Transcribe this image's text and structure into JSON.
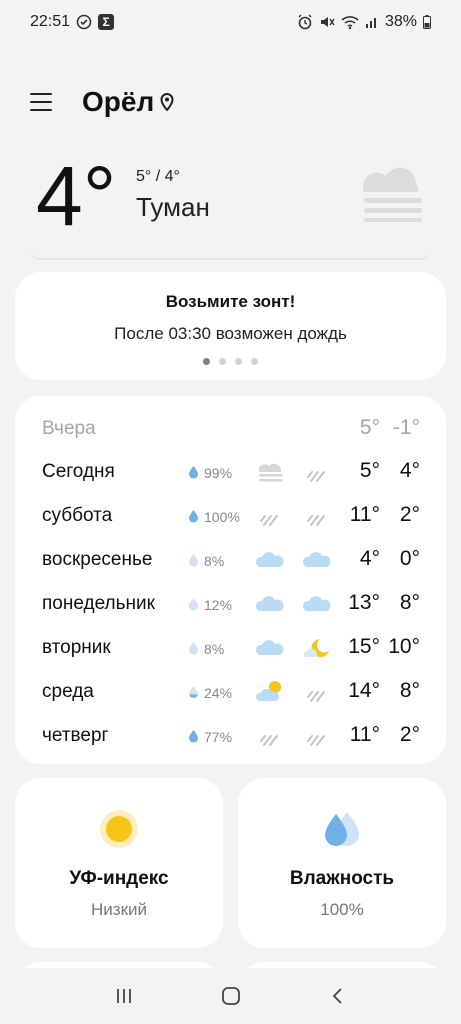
{
  "status_bar": {
    "time": "22:51",
    "battery": "38%",
    "icons": [
      "check-circle-icon",
      "sigma-icon",
      "alarm-icon",
      "mute-icon",
      "wifi-icon",
      "signal-icon",
      "battery-icon"
    ]
  },
  "header": {
    "city": "Орёл",
    "menu_icon": "menu-icon",
    "location_icon": "location-pin-icon"
  },
  "current": {
    "temp": "4°",
    "hilo": "5° / 4°",
    "condition": "Туман",
    "icon": "fog-icon"
  },
  "umbrella_card": {
    "title": "Возьмите зонт!",
    "text": "После 03:30 возможен дождь",
    "page_count": 4,
    "active_page": 1
  },
  "forecast": {
    "yesterday": {
      "day": "Вчера",
      "hi": "5°",
      "lo": "-1°"
    },
    "days": [
      {
        "day": "Сегодня",
        "pct": "99%",
        "icon1": "fog-icon",
        "icon2": "rain-icon",
        "hi": "5°",
        "lo": "4°"
      },
      {
        "day": "суббота",
        "pct": "100%",
        "icon1": "rain-icon",
        "icon2": "rain-icon",
        "hi": "11°",
        "lo": "2°"
      },
      {
        "day": "воскресенье",
        "pct": "8%",
        "icon1": "cloud-icon",
        "icon2": "cloud-icon",
        "hi": "4°",
        "lo": "0°"
      },
      {
        "day": "понедельник",
        "pct": "12%",
        "icon1": "cloud-icon",
        "icon2": "cloud-icon",
        "hi": "13°",
        "lo": "8°"
      },
      {
        "day": "вторник",
        "pct": "8%",
        "icon1": "cloud-icon",
        "icon2": "moon-cloud-icon",
        "hi": "15°",
        "lo": "10°"
      },
      {
        "day": "среда",
        "pct": "24%",
        "icon1": "sun-cloud-icon",
        "icon2": "rain-icon",
        "hi": "14°",
        "lo": "8°"
      },
      {
        "day": "четверг",
        "pct": "77%",
        "icon1": "rain-icon",
        "icon2": "rain-icon",
        "hi": "11°",
        "lo": "2°"
      }
    ]
  },
  "uv": {
    "title": "УФ-индекс",
    "value": "Низкий",
    "icon": "sun-icon"
  },
  "humidity": {
    "title": "Влажность",
    "value": "100%",
    "icon": "droplets-icon"
  },
  "colors": {
    "background": "#f3f3f3",
    "card": "#ffffff",
    "accent_blue": "#7ab8e8",
    "sun": "#f5c518"
  }
}
